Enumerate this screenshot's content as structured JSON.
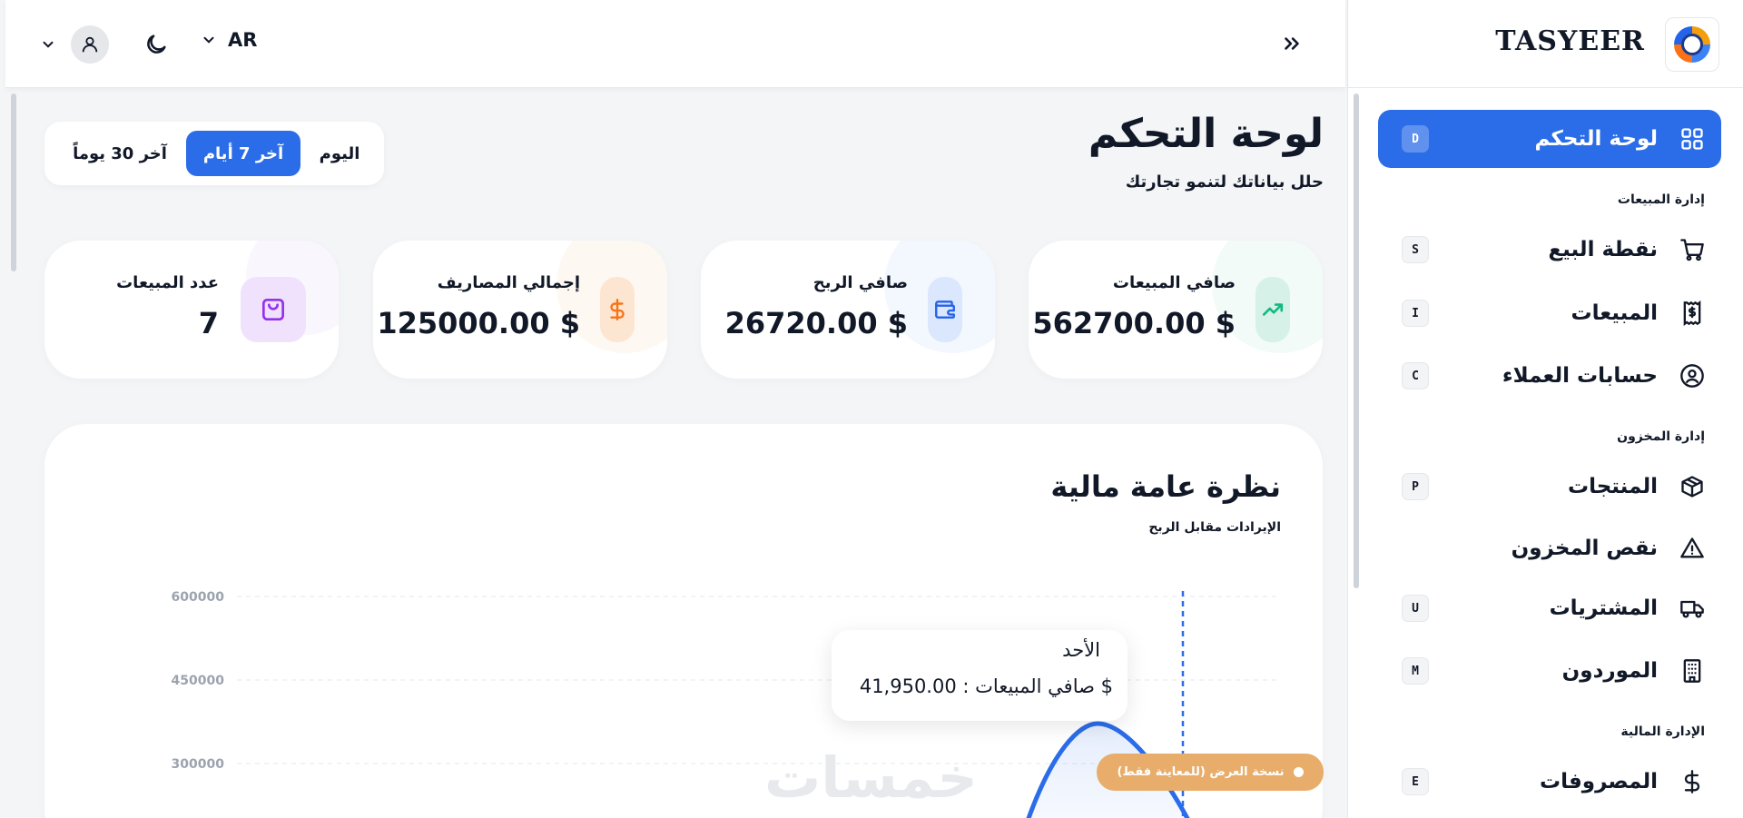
{
  "brand": {
    "name": "TASYEER"
  },
  "header": {
    "language": "AR"
  },
  "sidebar": {
    "items": [
      {
        "label": "لوحة التحكم",
        "key": "D",
        "icon": "dashboard-grid-icon",
        "active": true
      },
      {
        "label": "نقطة البيع",
        "key": "S",
        "icon": "cart-icon",
        "active": false
      },
      {
        "label": "المبيعات",
        "key": "I",
        "icon": "receipt-icon",
        "active": false
      },
      {
        "label": "حسابات العملاء",
        "key": "C",
        "icon": "user-circle-icon",
        "active": false
      },
      {
        "label": "المنتجات",
        "key": "P",
        "icon": "box-icon",
        "active": false
      },
      {
        "label": "نقص المخزون",
        "key": "",
        "icon": "warning-icon",
        "active": false
      },
      {
        "label": "المشتريات",
        "key": "U",
        "icon": "truck-icon",
        "active": false
      },
      {
        "label": "الموردون",
        "key": "M",
        "icon": "building-icon",
        "active": false
      },
      {
        "label": "المصروفات",
        "key": "E",
        "icon": "dollar-icon",
        "active": false
      }
    ],
    "sections": {
      "sales_management": "إدارة المبيعات",
      "inventory_management": "إدارة المخزون",
      "financial_management": "الإدارة المالية"
    }
  },
  "page": {
    "title": "لوحة التحكم",
    "subtitle": "حلل بياناتك لتنمو تجارتك"
  },
  "range": {
    "today": "اليوم",
    "last7": "آخر 7 أيام",
    "last30": "آخر 30 يوماً",
    "selected": "last7"
  },
  "stats": {
    "net_sales": {
      "label": "صافي المبيعات",
      "value": "562700.00 $",
      "color": "#10b981"
    },
    "net_profit": {
      "label": "صافي الربح",
      "value": "26720.00 $",
      "color": "#2563eb"
    },
    "total_expenses": {
      "label": "إجمالي المصاريف",
      "value": "125000.00 $",
      "color": "#f97316"
    },
    "sales_count": {
      "label": "عدد المبيعات",
      "value": "7",
      "color": "#9333ea"
    }
  },
  "chart_card": {
    "title": "نظرة عامة مالية",
    "subtitle": "الإيرادات مقابل الربح"
  },
  "tooltip": {
    "day": "الأحد",
    "value": "صافي المبيعات : 41,950.00 $"
  },
  "demo_badge": "نسخة العرض (للمعاينة فقط)",
  "watermark": "خمسات",
  "chart_data": {
    "type": "area",
    "title": "نظرة عامة مالية",
    "subtitle": "الإيرادات مقابل الربح",
    "y_ticks": [
      300000,
      450000,
      600000
    ],
    "ylim": [
      0,
      600000
    ],
    "grid": true,
    "series": [
      {
        "name": "صافي المبيعات",
        "color": "#2b6de8"
      }
    ],
    "highlight": {
      "day": "الأحد",
      "value": 41950
    }
  }
}
